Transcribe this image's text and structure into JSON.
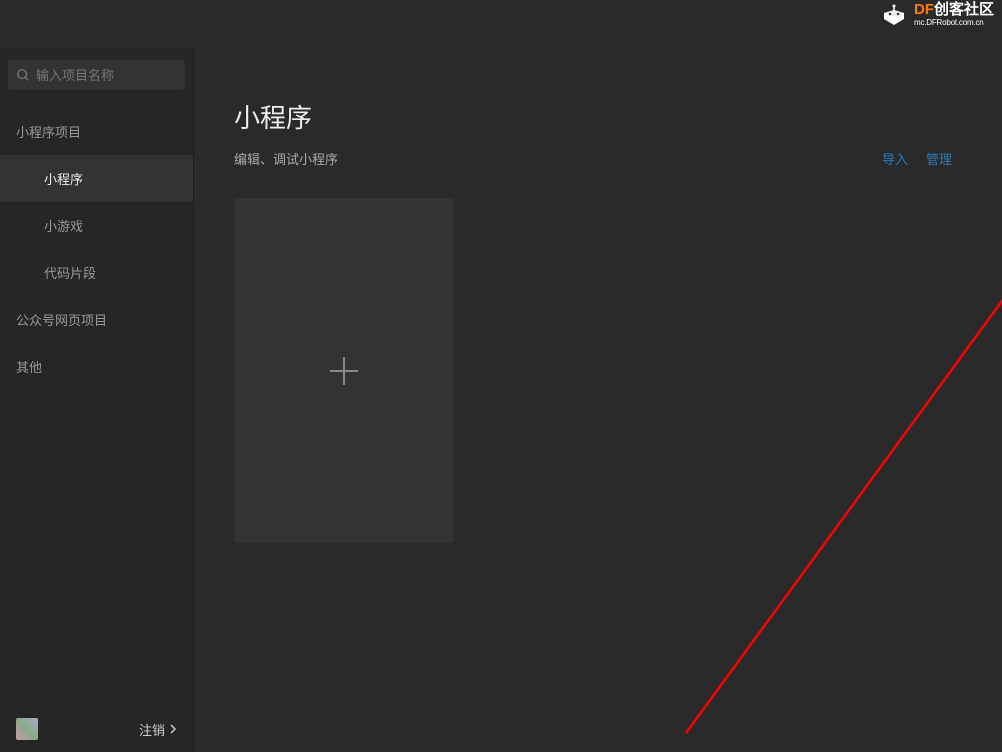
{
  "logo": {
    "brand_prefix": "DF",
    "brand_suffix": "创客社区",
    "domain": "mc.DFRobot.com.cn"
  },
  "search": {
    "placeholder": "输入项目名称"
  },
  "sidebar": {
    "cat1": "小程序项目",
    "items1": {
      "a": "小程序",
      "b": "小游戏",
      "c": "代码片段"
    },
    "cat2": "公众号网页项目",
    "cat3": "其他",
    "logout": "注销"
  },
  "main": {
    "title": "小程序",
    "subtitle": "编辑、调试小程序",
    "action_import": "导入",
    "action_manage": "管理"
  }
}
